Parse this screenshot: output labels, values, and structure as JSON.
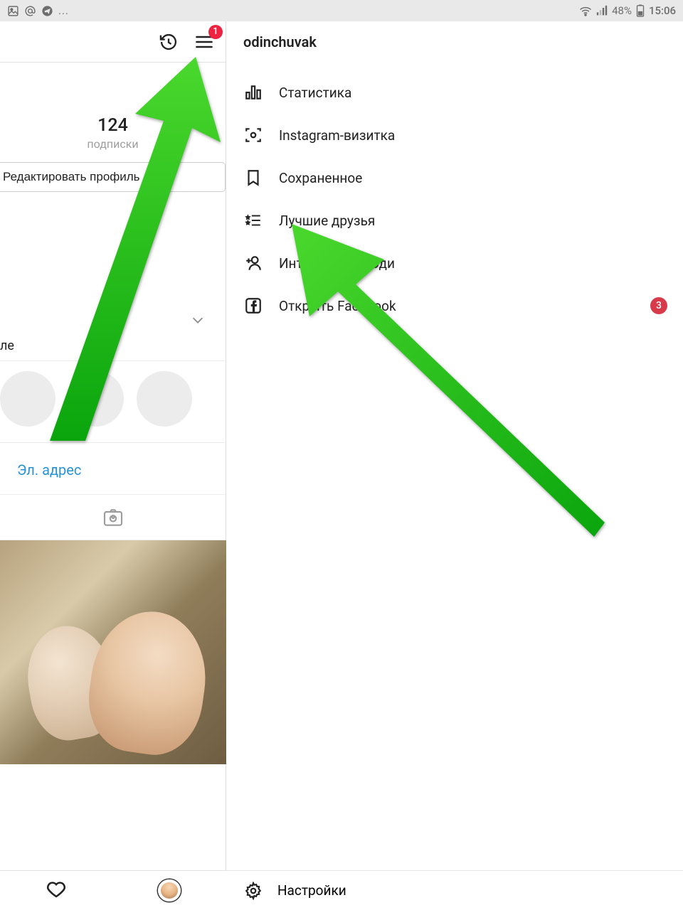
{
  "statusbar": {
    "battery_text": "48%",
    "time": "15:06"
  },
  "profile": {
    "hamburger_badge": "1",
    "stat_num": "124",
    "stat_label": "подписки",
    "edit_button": "Редактировать профиль",
    "section_le": "ле",
    "email_link": "Эл. адрес"
  },
  "drawer": {
    "title": "odinchuvak",
    "items": [
      {
        "label": "Статистика"
      },
      {
        "label": "Instagram-визитка"
      },
      {
        "label": "Сохраненное"
      },
      {
        "label": "Лучшие друзья"
      },
      {
        "label": "Интересные люди"
      },
      {
        "label": "Открыть Facebook",
        "badge": "3"
      }
    ],
    "footer": "Настройки"
  }
}
